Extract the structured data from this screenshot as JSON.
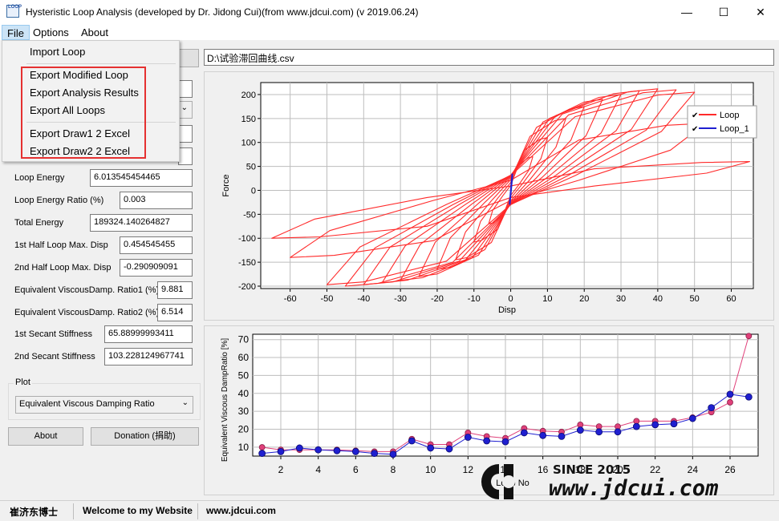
{
  "window": {
    "title": "Hysteristic Loop Analysis (developed by Dr. Jidong Cui)(from www.jdcui.com) (v 2019.06.24)",
    "icon_text": "LOOP",
    "controls": {
      "minimize": "—",
      "maximize": "☐",
      "close": "✕"
    }
  },
  "menu": {
    "items": [
      "File",
      "Options",
      "About"
    ]
  },
  "file_menu": {
    "items": [
      "Import Loop",
      "Export Modified Loop",
      "Export Analysis Results",
      "Export All Loops",
      "Export Draw1 2 Excel",
      "Export Draw2 2 Excel"
    ]
  },
  "file_path": "D:\\试验滞回曲线.csv",
  "fields": [
    {
      "label": "Loop Energy",
      "value": "6.013545454465"
    },
    {
      "label": "Loop Energy Ratio (%)",
      "value": "0.003"
    },
    {
      "label": "Total Energy",
      "value": "189324.140264827"
    },
    {
      "label": "1st Half Loop Max. Disp",
      "value": "0.454545455"
    },
    {
      "label": "2nd Half Loop Max. Disp",
      "value": "-0.290909091"
    },
    {
      "label": "Equivalent ViscousDamp. Ratio1 (%)",
      "value": "9.881"
    },
    {
      "label": "Equivalent ViscousDamp. Ratio2 (%)",
      "value": "6.514"
    },
    {
      "label": "1st Secant Stiffness",
      "value": "65.88999993411"
    },
    {
      "label": "2nd Secant Stiffness",
      "value": "103.228124967741"
    }
  ],
  "plot_group": {
    "title": "Plot",
    "selected": "Equivalent Viscous Damping Ratio"
  },
  "buttons": {
    "about": "About",
    "donation": "Donation (捐助)"
  },
  "status": [
    "崔济东博士",
    "Welcome to my Website",
    "www.jdcui.com"
  ],
  "watermark": {
    "since": "SINCE 2015",
    "site": "www.jdcui.com"
  },
  "colors": {
    "loop": "#ff2a2a",
    "loop_1": "#1f1fd0",
    "series1": "#e0407a",
    "series2": "#1f1fd0"
  },
  "chart_data": [
    {
      "type": "line",
      "title": "",
      "xlabel": "Disp",
      "ylabel": "Force",
      "xlim": [
        -68,
        66
      ],
      "ylim": [
        -205,
        225
      ],
      "xticks": [
        -60,
        -50,
        -40,
        -30,
        -20,
        -10,
        0,
        10,
        20,
        30,
        40,
        50,
        60
      ],
      "yticks": [
        -200,
        -150,
        -100,
        -50,
        0,
        50,
        100,
        150,
        200
      ],
      "grid": true,
      "legend": "top-right",
      "series": [
        {
          "name": "Loop",
          "color": "#ff2a2a",
          "loops": [
            {
              "dp": 6,
              "fp": 70,
              "dn": -6,
              "fn": -70
            },
            {
              "dp": 10,
              "fp": 110,
              "dn": -10,
              "fn": -108
            },
            {
              "dp": 15,
              "fp": 150,
              "dn": -15,
              "fn": -145
            },
            {
              "dp": 20,
              "fp": 175,
              "dn": -20,
              "fn": -165
            },
            {
              "dp": 25,
              "fp": 190,
              "dn": -25,
              "fn": -180
            },
            {
              "dp": 30,
              "fp": 200,
              "dn": -30,
              "fn": -188
            },
            {
              "dp": 35,
              "fp": 208,
              "dn": -35,
              "fn": -193
            },
            {
              "dp": 40,
              "fp": 212,
              "dn": -40,
              "fn": -197
            },
            {
              "dp": 45,
              "fp": 210,
              "dn": -45,
              "fn": -200
            },
            {
              "dp": 50,
              "fp": 205,
              "dn": -50,
              "fn": -197
            },
            {
              "dp": 53,
              "fp": 140,
              "dn": -60,
              "fn": -140
            },
            {
              "dp": 65,
              "fp": 60,
              "dn": -65,
              "fn": -100
            }
          ]
        },
        {
          "name": "Loop_1",
          "color": "#1f1fd0",
          "points": [
            [
              0.45,
              30
            ],
            [
              -0.29,
              -30
            ],
            [
              0.45,
              35
            ],
            [
              -0.29,
              -28
            ]
          ]
        }
      ]
    },
    {
      "type": "line",
      "title": "",
      "xlabel": "Loop No",
      "ylabel": "Equivalent Viscous DampRatio [%]",
      "xlim": [
        0.5,
        27.5
      ],
      "ylim": [
        5,
        73
      ],
      "xticks": [
        2,
        4,
        6,
        8,
        10,
        12,
        14,
        16,
        18,
        20,
        22,
        24,
        26
      ],
      "yticks": [
        10,
        20,
        30,
        40,
        50,
        60,
        70
      ],
      "grid": true,
      "x": [
        1,
        2,
        3,
        4,
        5,
        6,
        7,
        8,
        9,
        10,
        11,
        12,
        13,
        14,
        15,
        16,
        17,
        18,
        19,
        20,
        21,
        22,
        23,
        24,
        25,
        26,
        27
      ],
      "series": [
        {
          "color": "#e0407a",
          "values": [
            9.9,
            8.5,
            8.5,
            8.5,
            8.5,
            8,
            7.5,
            7.5,
            14.5,
            11.5,
            11.5,
            18,
            16,
            15,
            20.5,
            19,
            18.5,
            22.5,
            21.5,
            21.5,
            24.5,
            24.5,
            24.5,
            26.5,
            29.5,
            35,
            72
          ]
        },
        {
          "color": "#1f1fd0",
          "values": [
            6.5,
            7.5,
            9.5,
            8.5,
            8,
            7.5,
            6.5,
            6,
            13.5,
            9.5,
            9,
            15.5,
            13.5,
            13,
            18,
            16.5,
            16,
            19.5,
            18.5,
            18.5,
            21.5,
            22.5,
            23,
            26,
            32,
            39.5,
            38
          ]
        }
      ]
    }
  ]
}
